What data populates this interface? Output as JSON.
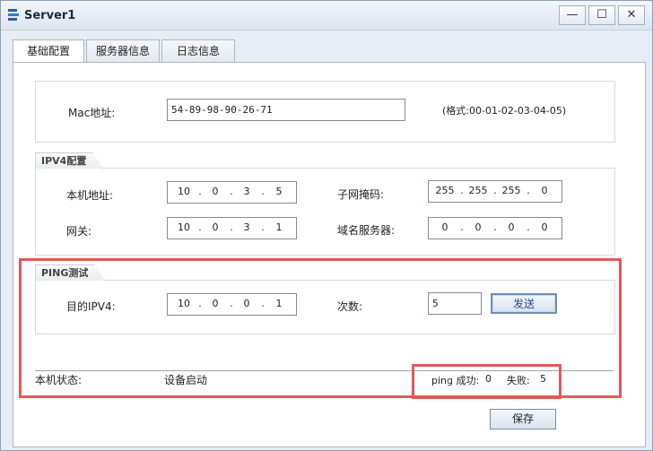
{
  "window": {
    "title": "Server1",
    "controls": {
      "minimize": "—",
      "maximize": "☐",
      "close": "✕"
    }
  },
  "tabs": [
    {
      "label": "基础配置"
    },
    {
      "label": "服务器信息"
    },
    {
      "label": "日志信息"
    }
  ],
  "mac": {
    "label": "Mac地址:",
    "value": "54-89-98-90-26-71",
    "hint": "(格式:00-01-02-03-04-05)"
  },
  "ipv4": {
    "group_label": "IPV4配置",
    "local_label": "本机地址:",
    "local": [
      "10",
      "0",
      "3",
      "5"
    ],
    "mask_label": "子网掩码:",
    "mask": [
      "255",
      "255",
      "255",
      "0"
    ],
    "gateway_label": "网关:",
    "gateway": [
      "10",
      "0",
      "3",
      "1"
    ],
    "dns_label": "域名服务器:",
    "dns": [
      "0",
      "0",
      "0",
      "0"
    ]
  },
  "ping": {
    "group_label": "PING测试",
    "dest_label": "目的IPV4:",
    "dest": [
      "10",
      "0",
      "0",
      "1"
    ],
    "count_label": "次数:",
    "count": "5",
    "send_label": "发送"
  },
  "status": {
    "label": "本机状态:",
    "value": "设备启动",
    "ping_success_label": "ping 成功:",
    "ping_success": "0",
    "fail_label": "失败:",
    "fail": "5"
  },
  "save_label": "保存",
  "colors": {
    "highlight_border": "#e05a5a",
    "accent_button_text": "#2a4a8a"
  }
}
